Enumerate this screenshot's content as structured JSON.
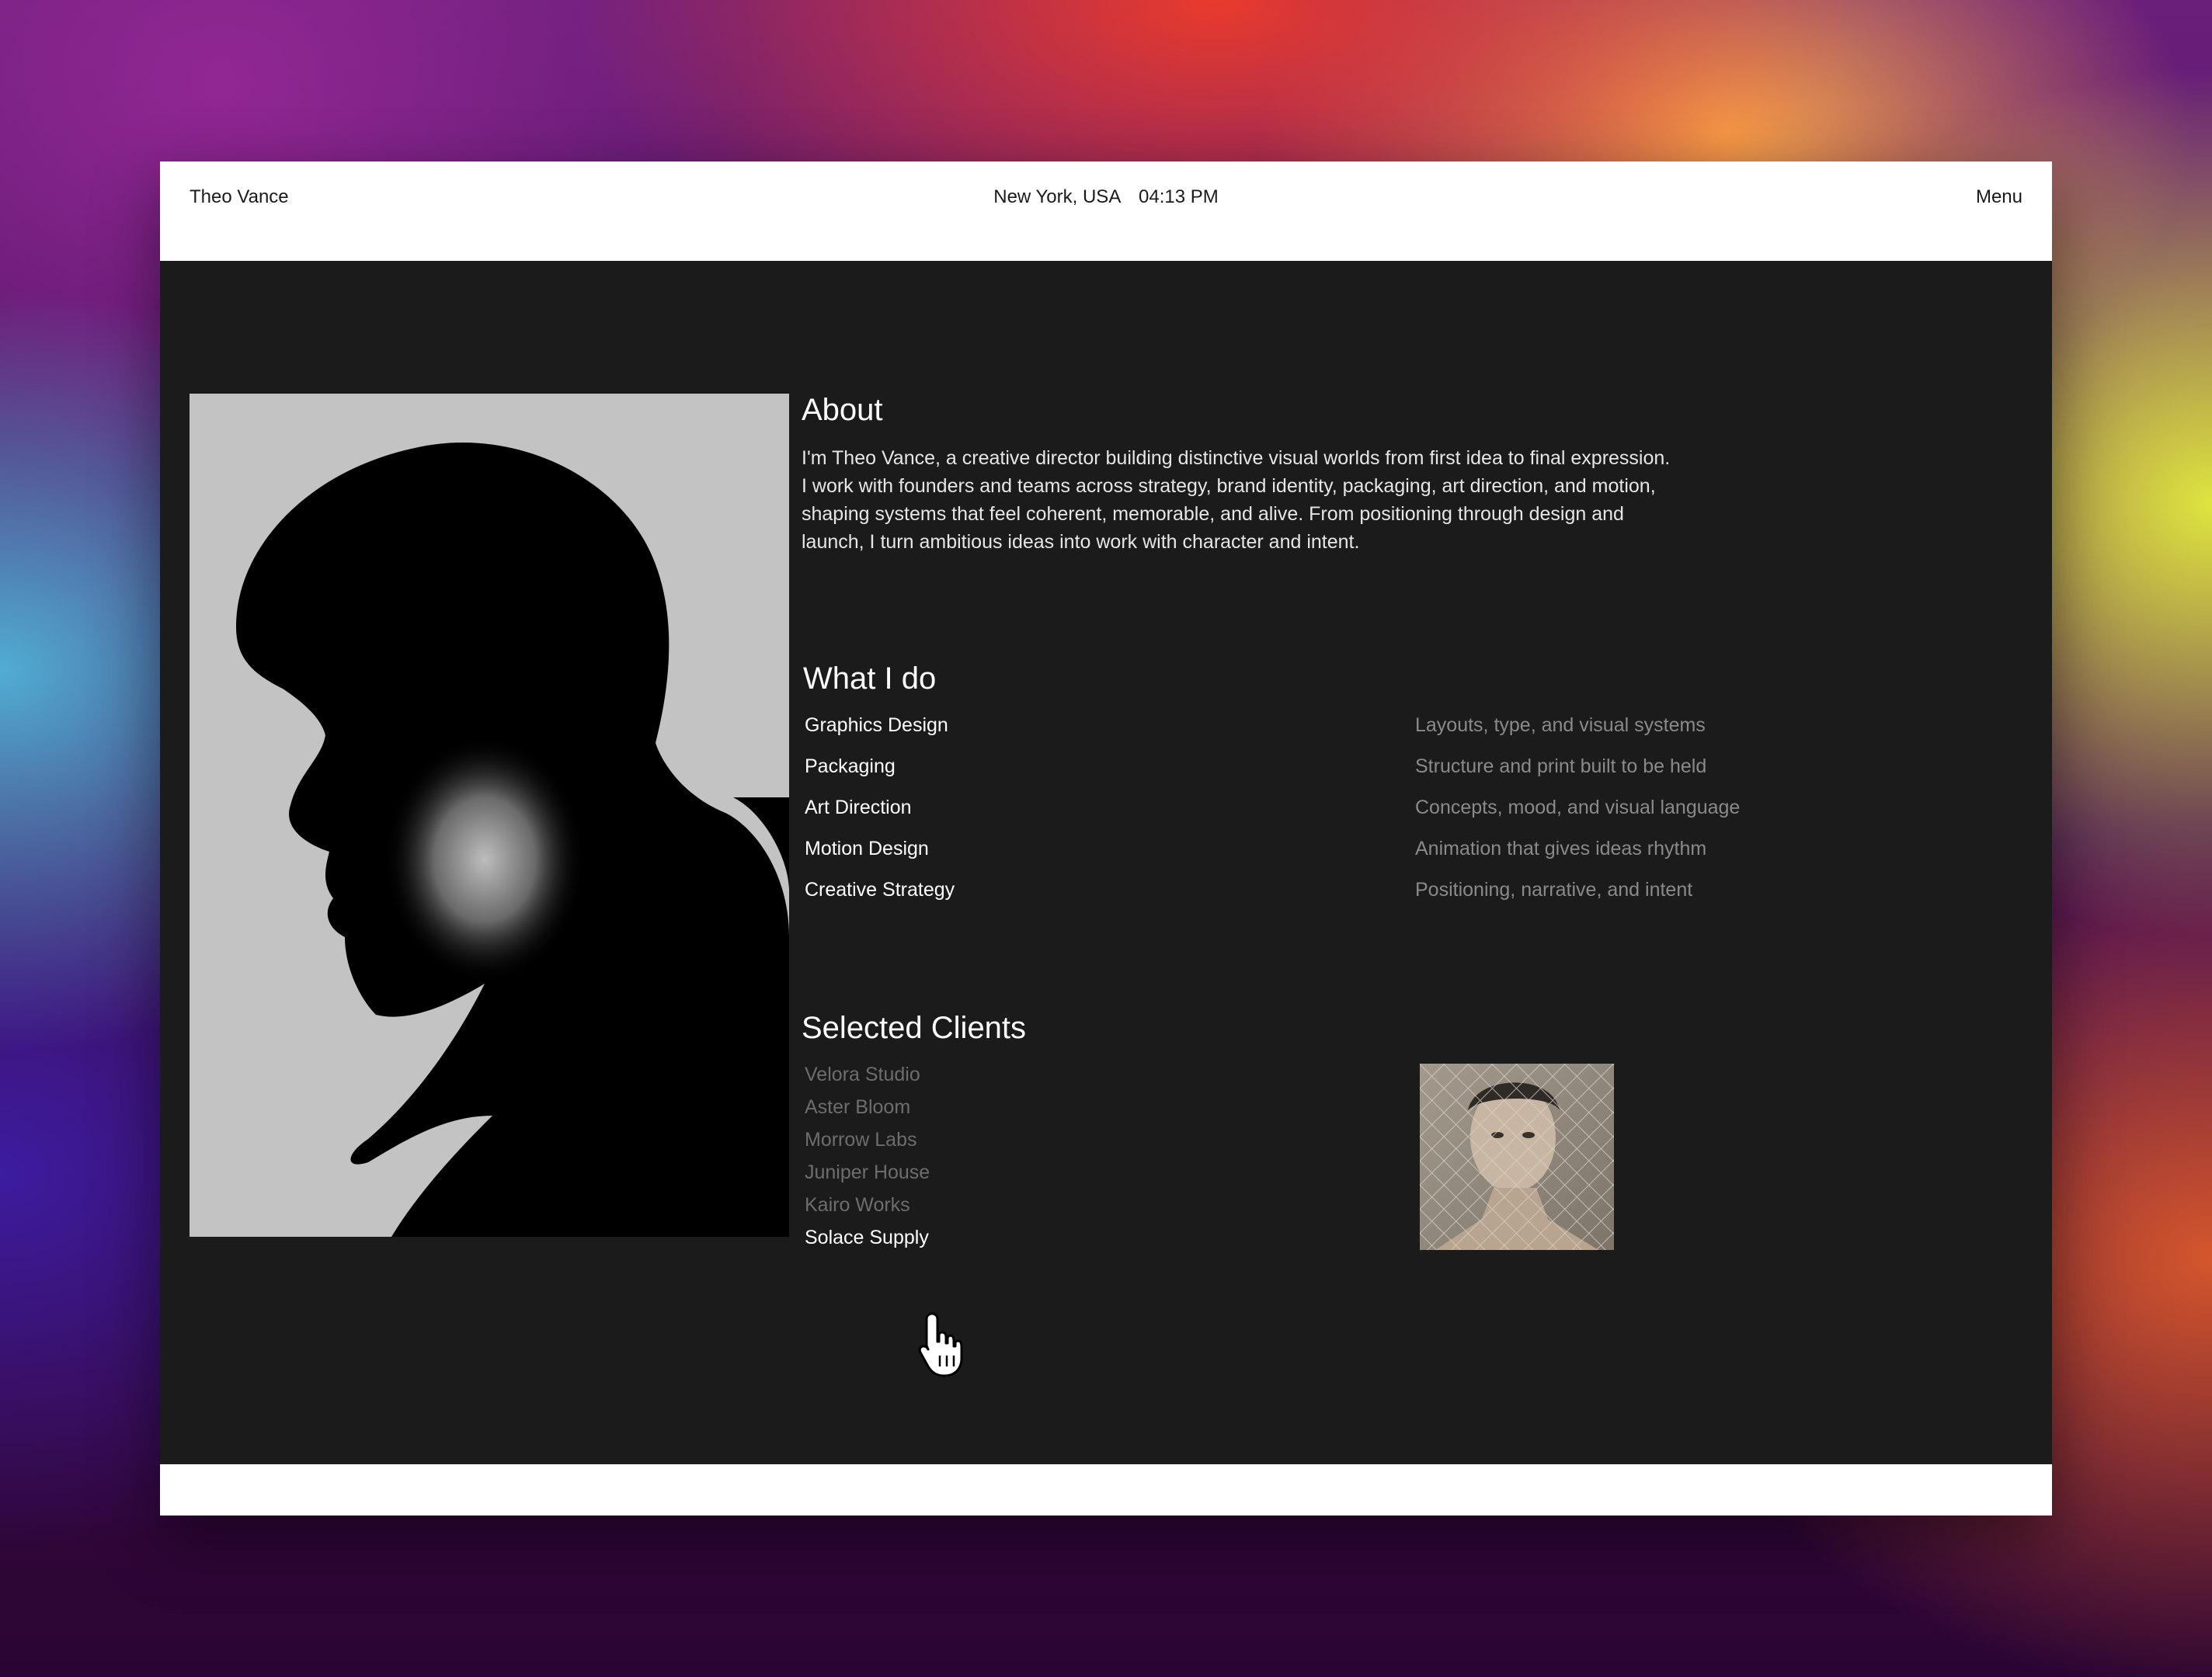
{
  "header": {
    "name": "Theo Vance",
    "location": "New York, USA",
    "time": "04:13 PM",
    "menu_label": "Menu"
  },
  "about": {
    "title": "About",
    "lines": [
      "I'm Theo Vance, a creative director building distinctive visual worlds from first idea to final expression.",
      "I work with founders and teams across strategy, brand identity, packaging, art direction, and motion,",
      "shaping systems that feel coherent, memorable, and alive. From positioning through design and",
      "launch, I turn ambitious ideas into work with character and intent."
    ]
  },
  "services": {
    "title": "What I do",
    "items": [
      {
        "name": "Graphics Design",
        "desc": "Layouts, type, and visual systems"
      },
      {
        "name": "Packaging",
        "desc": "Structure and print built to be held"
      },
      {
        "name": "Art Direction",
        "desc": "Concepts, mood, and visual language"
      },
      {
        "name": "Motion Design",
        "desc": "Animation that gives ideas rhythm"
      },
      {
        "name": "Creative Strategy",
        "desc": "Positioning, narrative, and intent"
      }
    ]
  },
  "clients": {
    "title": "Selected Clients",
    "items": [
      "Velora Studio",
      "Aster Bloom",
      "Morrow Labs",
      "Juniper House",
      "Kairo Works",
      "Solace Supply"
    ],
    "active": "Solace Supply"
  },
  "colors": {
    "page_bg": "#1b1b1b",
    "bar_bg": "#ffffff",
    "text_primary": "#ffffff",
    "text_muted": "#8a8a8a",
    "text_dim": "#6d6d6d"
  },
  "icons": {
    "cursor": "hand-pointer-icon"
  }
}
